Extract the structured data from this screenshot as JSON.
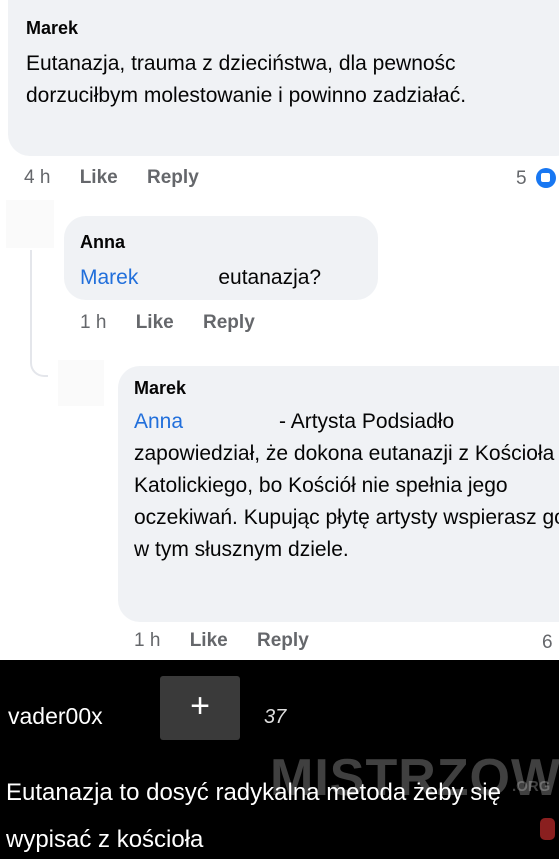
{
  "comments": [
    {
      "author": "Marek",
      "text": "Eutanazja, trauma z dzieciństwa, dla pewnośc dorzuciłbym molestowanie i powinno zadziałać.",
      "time": "4 h",
      "like_label": "Like",
      "reply_label": "Reply",
      "likes": "5"
    },
    {
      "author": "Anna",
      "mention": "Marek",
      "text": "eutanazja?",
      "time": "1 h",
      "like_label": "Like",
      "reply_label": "Reply"
    },
    {
      "author": "Marek",
      "mention": "Anna",
      "text_line1": "- Artysta Podsiadło",
      "text_rest": "zapowiedział, że dokona eutanazji z Kościoła Katolickiego, bo Kościół nie spełnia jego oczekiwań. Kupując płytę artysty wspierasz go w tym słusznym dziele.",
      "time": "1 h",
      "like_label": "Like",
      "reply_label": "Reply",
      "likes": "6"
    }
  ],
  "post": {
    "username": "vader00x",
    "plus_label": "+",
    "score": "37",
    "caption": "Eutanazja to dosyć radykalna metoda żeby się wypisać z kościoła",
    "watermark": "MISTRZOWIE",
    "watermark_suffix": ".ORG"
  }
}
